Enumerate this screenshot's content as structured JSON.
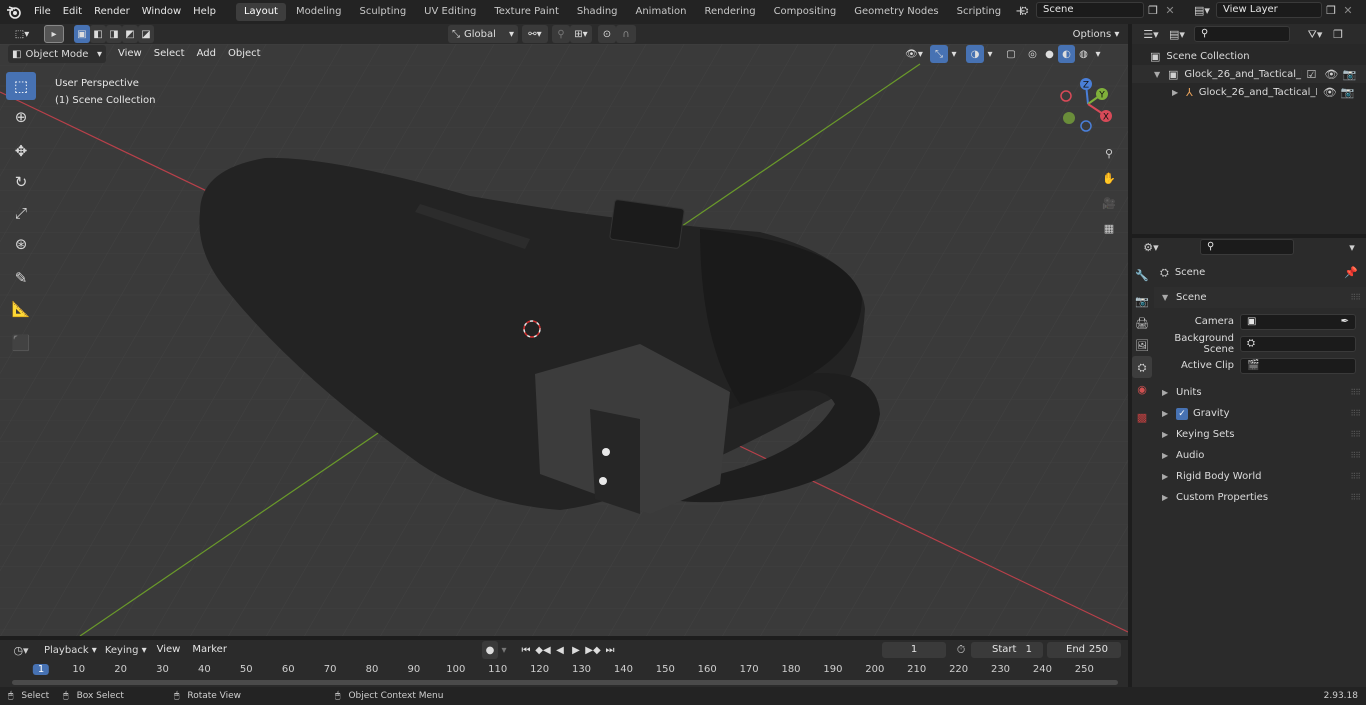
{
  "menu": {
    "items": [
      "File",
      "Edit",
      "Render",
      "Window",
      "Help"
    ]
  },
  "workspaces": [
    "Layout",
    "Modeling",
    "Sculpting",
    "UV Editing",
    "Texture Paint",
    "Shading",
    "Animation",
    "Rendering",
    "Compositing",
    "Geometry Nodes",
    "Scripting"
  ],
  "active_workspace": "Layout",
  "scene_field": "Scene",
  "view_layer_field": "View Layer",
  "viewport": {
    "mode": "Object Mode",
    "menus": [
      "View",
      "Select",
      "Add",
      "Object"
    ],
    "transform_orientation": "Global",
    "options": "Options",
    "info_line1": "User Perspective",
    "info_line2": "(1) Scene Collection",
    "gizmo": {
      "z": "Z",
      "y": "Y",
      "x": "X"
    }
  },
  "outliner": {
    "root": "Scene Collection",
    "items": [
      {
        "label": "Glock_26_and_Tactical_Nylon_"
      },
      {
        "label": "Glock_26_and_Tactical_N"
      }
    ]
  },
  "properties": {
    "breadcrumb": "Scene",
    "section": "Scene",
    "rows": [
      {
        "label": "Camera"
      },
      {
        "label": "Background Scene"
      },
      {
        "label": "Active Clip"
      }
    ],
    "panels": [
      "Units",
      "Gravity",
      "Keying Sets",
      "Audio",
      "Rigid Body World",
      "Custom Properties"
    ]
  },
  "timeline": {
    "menus": [
      "Playback",
      "Keying",
      "View",
      "Marker"
    ],
    "current_frame": "1",
    "start_label": "Start",
    "start_value": "1",
    "end_label": "End",
    "end_value": "250",
    "ticks": [
      "1",
      "10",
      "20",
      "30",
      "40",
      "50",
      "60",
      "70",
      "80",
      "90",
      "100",
      "110",
      "120",
      "130",
      "140",
      "150",
      "160",
      "170",
      "180",
      "190",
      "200",
      "210",
      "220",
      "230",
      "240",
      "250"
    ]
  },
  "status": {
    "items": [
      "Select",
      "Box Select",
      "Rotate View",
      "Object Context Menu"
    ],
    "version": "2.93.18"
  },
  "colors": {
    "accent": "#4772b3",
    "x_axis": "#b8404a",
    "y_axis": "#6a9a2a"
  }
}
